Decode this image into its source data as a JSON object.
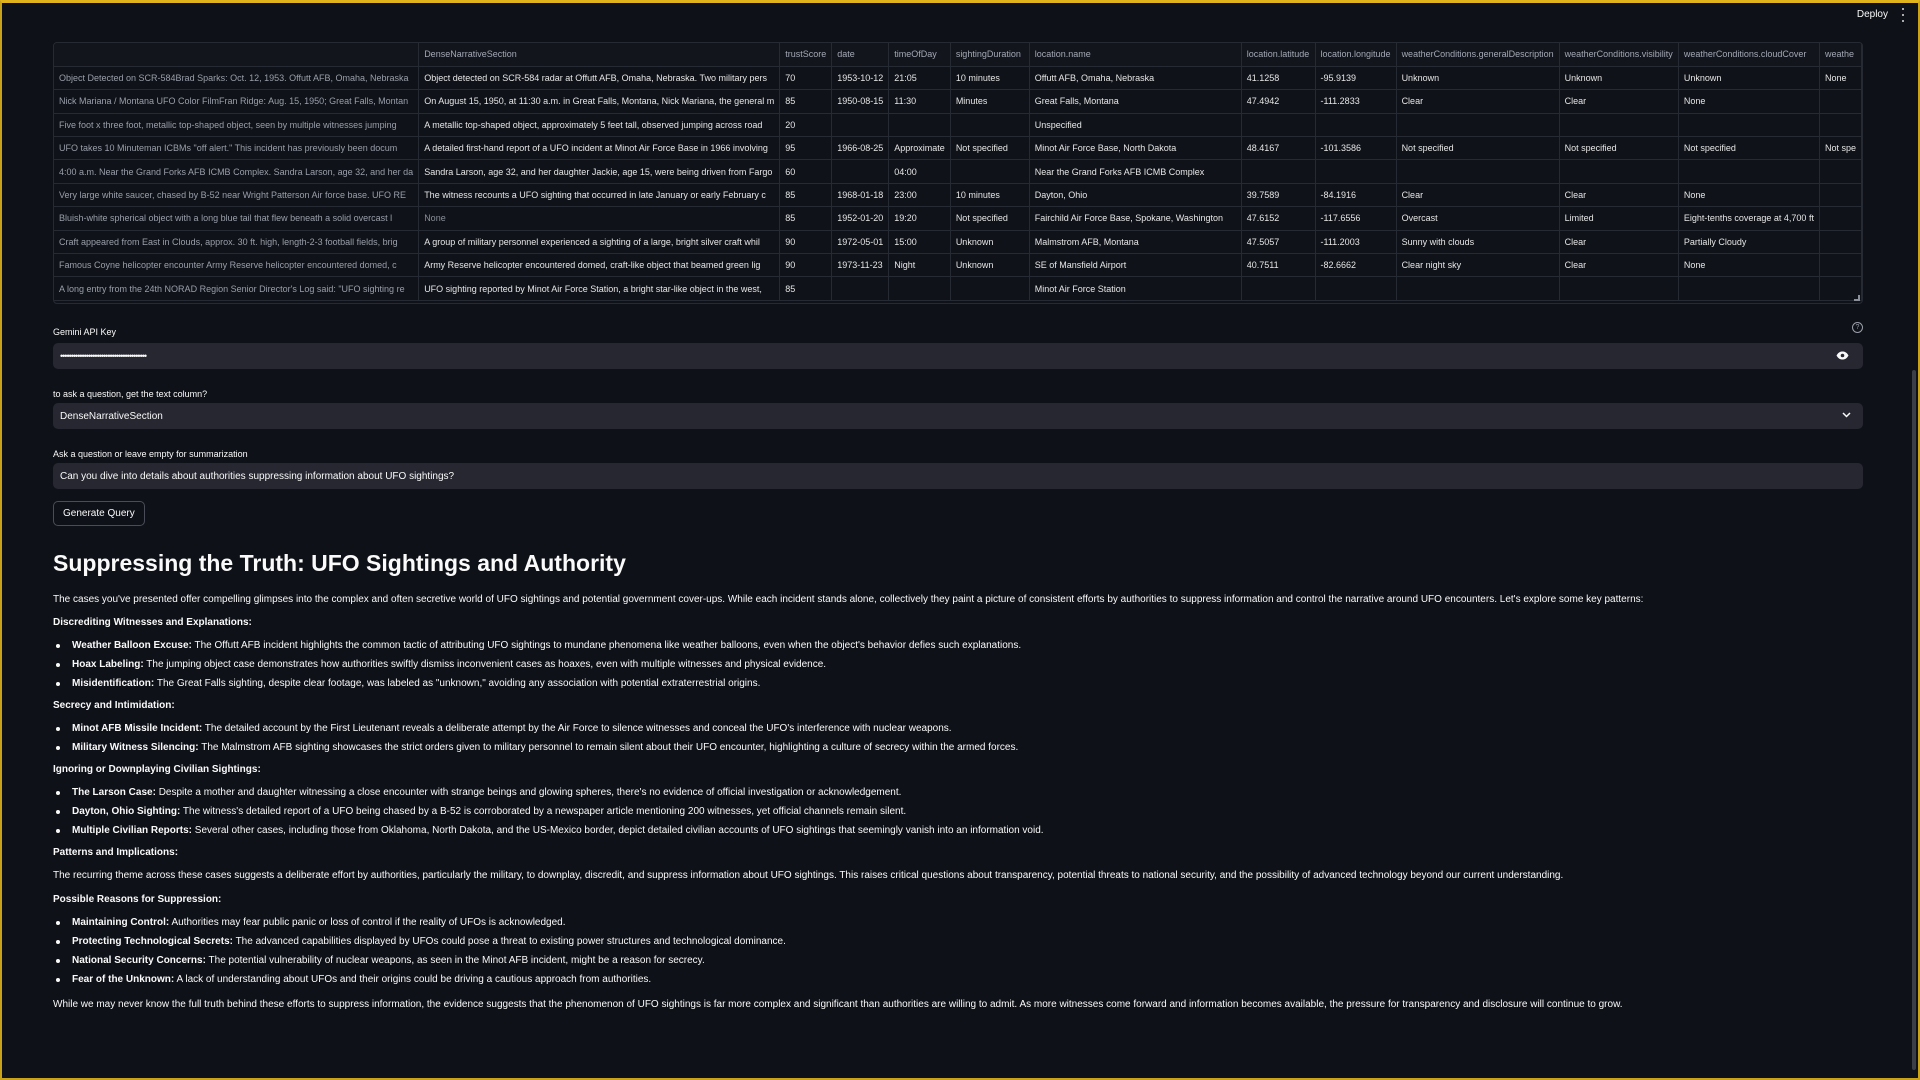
{
  "header": {
    "deploy_label": "Deploy"
  },
  "table": {
    "columns": [
      "",
      "DenseNarrativeSection",
      "trustScore",
      "date",
      "timeOfDay",
      "sightingDuration",
      "location.name",
      "location.latitude",
      "location.longitude",
      "weatherConditions.generalDescription",
      "weatherConditions.visibility",
      "weatherConditions.cloudCover",
      "weathe"
    ],
    "rows": [
      [
        "Object Detected on SCR-584Brad Sparks: Oct. 12, 1953. Offutt AFB, Omaha, Nebraska",
        "Object detected on SCR-584 radar at Offutt AFB, Omaha, Nebraska. Two military pers",
        "70",
        "1953-10-12",
        "21:05",
        "10 minutes",
        "Offutt AFB, Omaha, Nebraska",
        "41.1258",
        "-95.9139",
        "Unknown",
        "Unknown",
        "Unknown",
        "None"
      ],
      [
        "Nick Mariana / Montana UFO Color FilmFran Ridge: Aug. 15, 1950; Great Falls, Montan",
        "On August 15, 1950, at 11:30 a.m. in Great Falls, Montana, Nick Mariana, the general m",
        "85",
        "1950-08-15",
        "11:30",
        "Minutes",
        "Great Falls, Montana",
        "47.4942",
        "-111.2833",
        "Clear",
        "Clear",
        "None",
        ""
      ],
      [
        "Five foot x three foot, metallic top-shaped object, seen by multiple witnesses jumping",
        "A metallic top-shaped object, approximately 5 feet tall, observed jumping across road",
        "20",
        "",
        "",
        "",
        "Unspecified",
        "",
        "",
        "",
        "",
        "",
        ""
      ],
      [
        "UFO takes 10 Minuteman ICBMs \"off alert.\" This incident has previously been docum",
        "A detailed first-hand report of a UFO incident at Minot Air Force Base in 1966 involving",
        "95",
        "1966-08-25",
        "Approximate",
        "Not specified",
        "Minot Air Force Base, North Dakota",
        "48.4167",
        "-101.3586",
        "Not specified",
        "Not specified",
        "Not specified",
        "Not spe"
      ],
      [
        "4:00 a.m. Near the Grand Forks AFB ICMB Complex. Sandra Larson, age 32, and her da",
        "Sandra Larson, age 32, and her daughter Jackie, age 15, were being driven from Fargo",
        "60",
        "",
        "04:00",
        "",
        "Near the Grand Forks AFB ICMB Complex",
        "",
        "",
        "",
        "",
        "",
        ""
      ],
      [
        "Very large white saucer, chased by B-52 near Wright Patterson Air force base.  UFO RE",
        "The witness recounts a UFO sighting that occurred in late January or early February c",
        "85",
        "1968-01-18",
        "23:00",
        "10 minutes",
        "Dayton, Ohio",
        "39.7589",
        "-84.1916",
        "Clear",
        "Clear",
        "None",
        ""
      ],
      [
        "Bluish-white spherical object with a long blue tail that flew beneath a solid overcast l",
        "None",
        "85",
        "1952-01-20",
        "19:20",
        "Not specified",
        "Fairchild Air Force Base, Spokane, Washington",
        "47.6152",
        "-117.6556",
        "Overcast",
        "Limited",
        "Eight-tenths coverage at 4,700 ft",
        ""
      ],
      [
        "Craft appeared from East in Clouds, approx. 30 ft. high, length-2-3 football fields, brig",
        "A group of military personnel experienced a sighting of a large, bright silver craft whil",
        "90",
        "1972-05-01",
        "15:00",
        "Unknown",
        "Malmstrom AFB, Montana",
        "47.5057",
        "-111.2003",
        "Sunny with clouds",
        "Clear",
        "Partially Cloudy",
        ""
      ],
      [
        "Famous Coyne helicopter encounter  Army Reserve helicopter encountered domed, c",
        "Army Reserve helicopter encountered domed, craft-like object that beamed green lig",
        "90",
        "1973-11-23",
        "Night",
        "Unknown",
        "SE of Mansfield Airport",
        "40.7511",
        "-82.6662",
        "Clear night sky",
        "Clear",
        "None",
        ""
      ],
      [
        "A long entry from the 24th NORAD Region Senior Director's Log said: \"UFO sighting re",
        "UFO sighting reported by Minot Air Force Station, a bright star-like object in the west,",
        "85",
        "",
        "",
        "",
        "Minot Air Force Station",
        "",
        "",
        "",
        "",
        "",
        ""
      ]
    ]
  },
  "api_key": {
    "label": "Gemini API Key",
    "value": "••••••••••••••••••••••••••••••••••••••••"
  },
  "text_column": {
    "label": "to ask a question, get the text column?",
    "selected": "DenseNarrativeSection"
  },
  "question": {
    "label": "Ask a question or leave empty for summarization",
    "value": "Can you dive into details about authorities suppressing information about UFO sightings?"
  },
  "generate_button": "Generate Query",
  "article": {
    "title": "Suppressing the Truth: UFO Sightings and Authority",
    "intro": "The cases you've presented offer compelling glimpses into the complex and often secretive world of UFO sightings and potential government cover-ups. While each incident stands alone, collectively they paint a picture of consistent efforts by authorities to suppress information and control the narrative around UFO encounters. Let's explore some key patterns:",
    "sections": [
      {
        "heading": "Discrediting Witnesses and Explanations:",
        "items": [
          {
            "term": "Weather Balloon Excuse:",
            "text": " The Offutt AFB incident highlights the common tactic of attributing UFO sightings to mundane phenomena like weather balloons, even when the object's behavior defies such explanations."
          },
          {
            "term": "Hoax Labeling:",
            "text": " The jumping object case demonstrates how authorities swiftly dismiss inconvenient cases as hoaxes, even with multiple witnesses and physical evidence."
          },
          {
            "term": "Misidentification:",
            "text": " The Great Falls sighting, despite clear footage, was labeled as \"unknown,\" avoiding any association with potential extraterrestrial origins."
          }
        ]
      },
      {
        "heading": "Secrecy and Intimidation:",
        "items": [
          {
            "term": "Minot AFB Missile Incident:",
            "text": " The detailed account by the First Lieutenant reveals a deliberate attempt by the Air Force to silence witnesses and conceal the UFO's interference with nuclear weapons."
          },
          {
            "term": "Military Witness Silencing:",
            "text": " The Malmstrom AFB sighting showcases the strict orders given to military personnel to remain silent about their UFO encounter, highlighting a culture of secrecy within the armed forces."
          }
        ]
      },
      {
        "heading": "Ignoring or Downplaying Civilian Sightings:",
        "items": [
          {
            "term": "The Larson Case:",
            "text": " Despite a mother and daughter witnessing a close encounter with strange beings and glowing spheres, there's no evidence of official investigation or acknowledgement."
          },
          {
            "term": "Dayton, Ohio Sighting:",
            "text": " The witness's detailed report of a UFO being chased by a B-52 is corroborated by a newspaper article mentioning 200 witnesses, yet official channels remain silent."
          },
          {
            "term": "Multiple Civilian Reports:",
            "text": " Several other cases, including those from Oklahoma, North Dakota, and the US-Mexico border, depict detailed civilian accounts of UFO sightings that seemingly vanish into an information void."
          }
        ]
      }
    ],
    "patterns_heading": "Patterns and Implications:",
    "patterns_text": "The recurring theme across these cases suggests a deliberate effort by authorities, particularly the military, to downplay, discredit, and suppress information about UFO sightings. This raises critical questions about transparency, potential threats to national security, and the possibility of advanced technology beyond our current understanding.",
    "reasons_heading": "Possible Reasons for Suppression:",
    "reasons": [
      {
        "term": "Maintaining Control:",
        "text": " Authorities may fear public panic or loss of control if the reality of UFOs is acknowledged."
      },
      {
        "term": "Protecting Technological Secrets:",
        "text": " The advanced capabilities displayed by UFOs could pose a threat to existing power structures and technological dominance."
      },
      {
        "term": "National Security Concerns:",
        "text": " The potential vulnerability of nuclear weapons, as seen in the Minot AFB incident, might be a reason for secrecy."
      },
      {
        "term": "Fear of the Unknown:",
        "text": " A lack of understanding about UFOs and their origins could be driving a cautious approach from authorities."
      }
    ],
    "conclusion": "While we may never know the full truth behind these efforts to suppress information, the evidence suggests that the phenomenon of UFO sightings is far more complex and significant than authorities are willing to admit. As more witnesses come forward and information becomes available, the pressure for transparency and disclosure will continue to grow."
  }
}
